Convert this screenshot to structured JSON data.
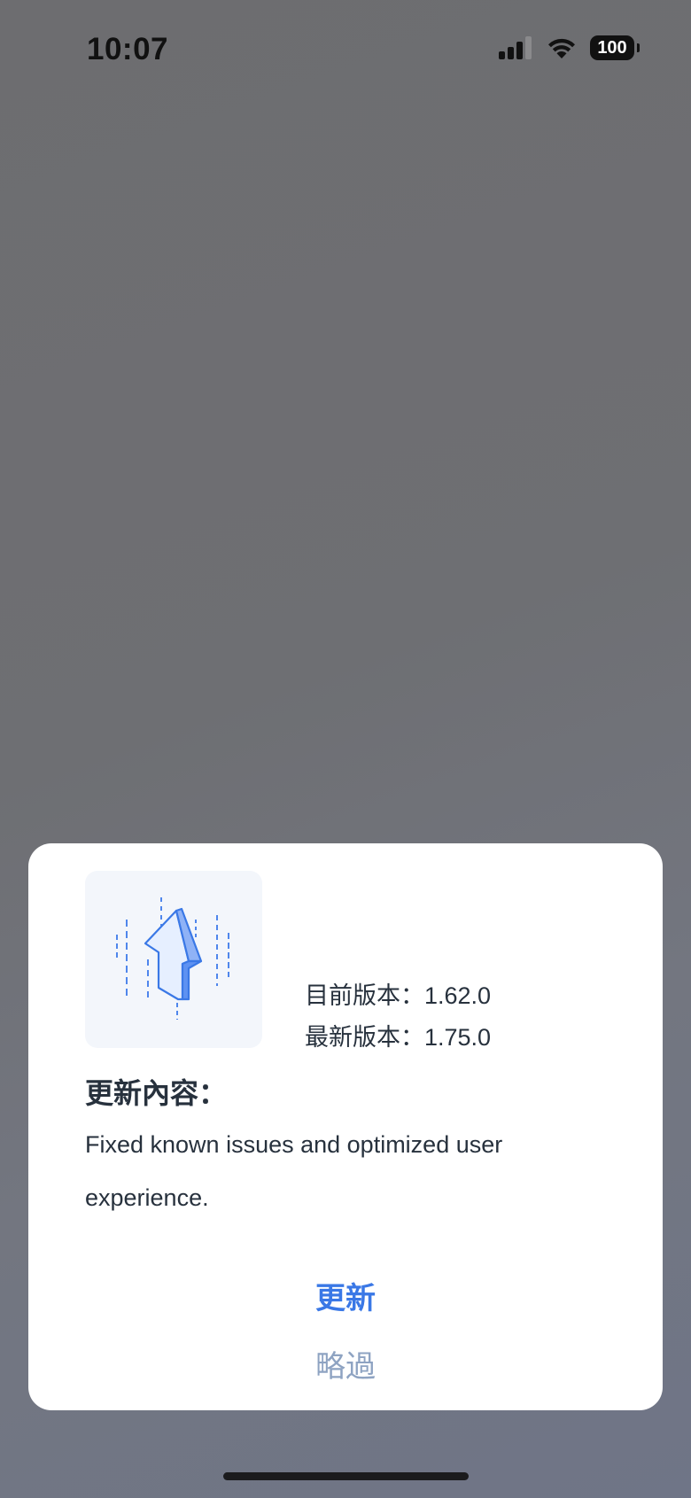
{
  "status_bar": {
    "time": "10:07",
    "battery": "100"
  },
  "dialog": {
    "current_version": "目前版本：1.62.0",
    "latest_version": "最新版本：1.75.0",
    "content_title": "更新內容：",
    "content_text": "Fixed known issues and optimized user experience.",
    "update_label": "更新",
    "skip_label": "略過"
  },
  "colors": {
    "accent": "#3a78e6",
    "skip": "#8ea3c2",
    "text": "#27313d"
  }
}
